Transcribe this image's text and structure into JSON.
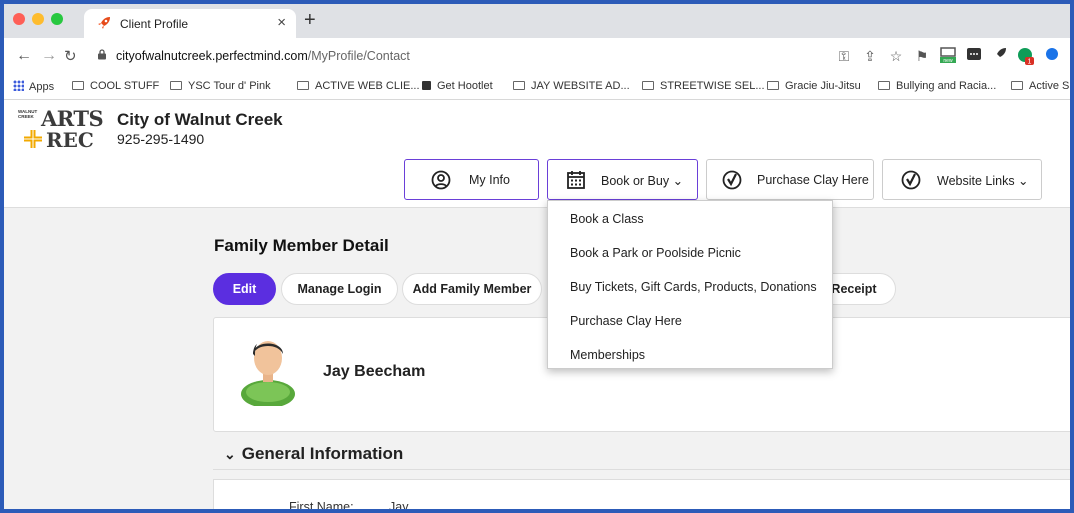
{
  "browser": {
    "tab": {
      "title": "Client Profile",
      "close": "×"
    },
    "new_tab": "+",
    "address": {
      "host": "cityofwalnutcreek.perfectmind.com",
      "path": "/MyProfile/Contact"
    },
    "bookmarks": [
      {
        "label": "Apps",
        "icon": "apps-grid-icon"
      },
      {
        "label": "COOL STUFF",
        "icon": "folder-icon"
      },
      {
        "label": "YSC Tour d' Pink",
        "icon": "folder-icon"
      },
      {
        "label": "ACTIVE WEB CLIE...",
        "icon": "folder-icon"
      },
      {
        "label": "Get Hootlet",
        "icon": "hootlet-icon"
      },
      {
        "label": "JAY WEBSITE AD...",
        "icon": "folder-icon"
      },
      {
        "label": "STREETWISE SEL...",
        "icon": "folder-icon"
      },
      {
        "label": "Gracie Jiu-Jitsu",
        "icon": "folder-icon"
      },
      {
        "label": "Bullying and Racia...",
        "icon": "folder-icon"
      },
      {
        "label": "Active Sh",
        "icon": "folder-icon"
      }
    ],
    "ext_badge_new": "new",
    "ext_badge_count": "1"
  },
  "header": {
    "logo_small": "WALNUT CREEK",
    "logo_arts": "ARTS",
    "logo_rec": "REC",
    "org_name": "City of Walnut Creek",
    "phone": "925-295-1490",
    "nav": {
      "my_info": "My Info",
      "book_or_buy": "Book or Buy ⌄",
      "purchase_clay": "Purchase Clay Here",
      "website_links": "Website Links ⌄"
    }
  },
  "dropdown": {
    "items": [
      "Book a Class",
      "Book a Park or Poolside Picnic",
      "Buy Tickets, Gift Cards, Products, Donations",
      "Purchase Clay Here",
      "Memberships"
    ]
  },
  "main": {
    "title": "Family Member Detail",
    "actions": {
      "edit": "Edit",
      "manage_login": "Manage Login",
      "add_family": "Add Family Member",
      "receipt": "Receipt"
    },
    "person_name": "Jay Beecham",
    "section": "General Information",
    "fields": [
      {
        "label": "First Name:",
        "value": "Jay"
      }
    ]
  },
  "colors": {
    "accent": "#5b2ee0",
    "browser_border": "#2c5bb8"
  }
}
